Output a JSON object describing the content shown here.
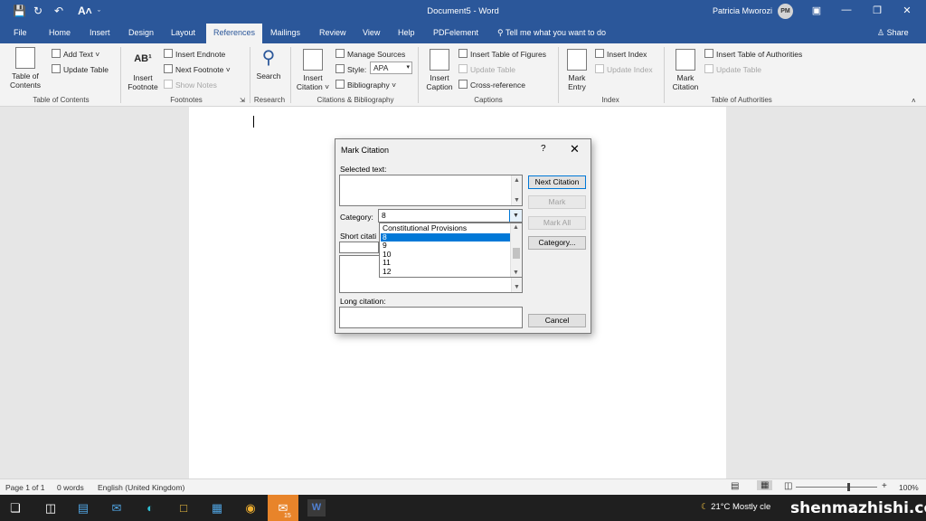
{
  "titlebar": {
    "title": "Document5 - Word",
    "user": "Patricia Mworozi",
    "avatar_initials": "PM",
    "save_icon": "save-icon",
    "autosave_icon": "autosave-icon",
    "undo_icon": "undo-icon",
    "font_size_icon": "A˄",
    "qat_menu_icon": "chevron-down-icon"
  },
  "tabs": [
    "File",
    "Home",
    "Insert",
    "Design",
    "Layout",
    "References",
    "Mailings",
    "Review",
    "View",
    "Help",
    "PDFelement"
  ],
  "active_tab": "References",
  "tell_me": "Tell me what you want to do",
  "share": "Share",
  "ribbon": {
    "toc": {
      "table_of_contents": "Table of Contents",
      "add_text": "Add Text ˅",
      "update_table": "Update Table",
      "group": "Table of Contents"
    },
    "footnotes": {
      "insert_footnote": "Insert Footnote",
      "insert_endnote": "Insert Endnote",
      "next_footnote": "Next Footnote ˅",
      "show_notes": "Show Notes",
      "group": "Footnotes"
    },
    "research": {
      "search": "Search",
      "group": "Research"
    },
    "citations": {
      "insert_citation": "Insert Citation ˅",
      "manage_sources": "Manage Sources",
      "style_label": "Style:",
      "style_value": "APA",
      "bibliography": "Bibliography ˅",
      "group": "Citations & Bibliography"
    },
    "captions": {
      "insert_caption": "Insert Caption",
      "insert_table_of_figures": "Insert Table of Figures",
      "update_table": "Update Table",
      "cross_reference": "Cross-reference",
      "group": "Captions"
    },
    "index": {
      "mark_entry": "Mark Entry",
      "insert_index": "Insert Index",
      "update_index": "Update Index",
      "group": "Index"
    },
    "authorities": {
      "mark_citation": "Mark Citation",
      "insert_table_of_authorities": "Insert Table of Authorities",
      "update_table": "Update Table",
      "group": "Table of Authorities"
    }
  },
  "dialog": {
    "title": "Mark Citation",
    "help": "?",
    "close": "✕",
    "selected_text_label": "Selected text:",
    "category_label": "Category:",
    "category_value": "8",
    "short_citation_label": "Short citati",
    "long_citation_label": "Long citation:",
    "buttons": {
      "next_citation": "Next Citation",
      "mark": "Mark",
      "mark_all": "Mark All",
      "category": "Category...",
      "cancel": "Cancel"
    },
    "dropdown_items": [
      "Constitutional Provisions",
      "8",
      "9",
      "10",
      "11",
      "12"
    ],
    "selected_item": "8"
  },
  "statusbar": {
    "page": "Page 1 of 1",
    "words": "0 words",
    "language": "English (United Kingdom)",
    "zoom": "100%",
    "zoom_fraction": 0.64
  },
  "taskbar": {
    "weather": "21°C  Mostly cle",
    "badge": "15",
    "watermark": "shenmazhishi.com",
    "icons": [
      "windows-start-icon",
      "task-view-icon",
      "store-icon",
      "mail-icon",
      "edge-icon",
      "file-explorer-icon",
      "calculator-icon",
      "chrome-icon",
      "messaging-icon",
      "word-icon"
    ]
  },
  "colors": {
    "word_blue": "#2b579a",
    "selection_blue": "#0078d7",
    "taskbar": "#1f1f1f"
  }
}
